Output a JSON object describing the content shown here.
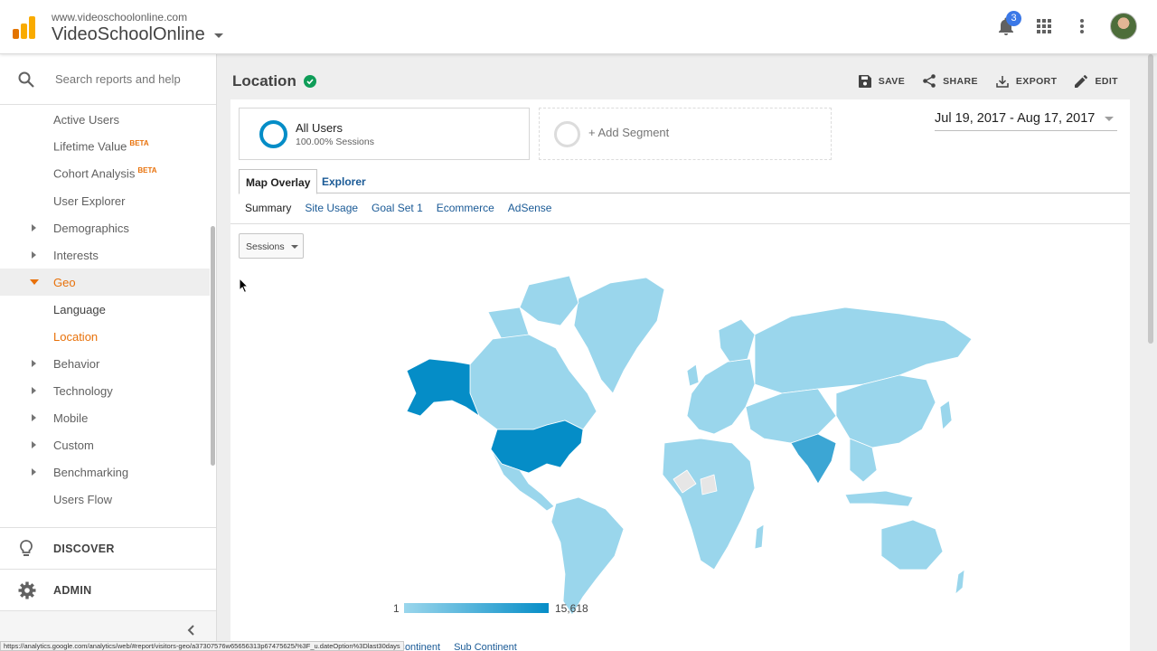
{
  "header": {
    "account_url": "www.videoschoolonline.com",
    "account_name": "VideoSchoolOnline",
    "notification_count": "3",
    "icons": [
      "analytics-logo-icon",
      "bell-icon",
      "apps-grid-icon",
      "more-vert-icon",
      "avatar"
    ]
  },
  "sidebar": {
    "search_placeholder": "Search reports and help",
    "items": [
      {
        "label": "Active Users"
      },
      {
        "label": "Lifetime Value",
        "badge": "BETA"
      },
      {
        "label": "Cohort Analysis",
        "badge": "BETA"
      },
      {
        "label": "User Explorer"
      },
      {
        "label": "Demographics"
      },
      {
        "label": "Interests"
      },
      {
        "label": "Geo"
      },
      {
        "label": "Language"
      },
      {
        "label": "Location"
      },
      {
        "label": "Behavior"
      },
      {
        "label": "Technology"
      },
      {
        "label": "Mobile"
      },
      {
        "label": "Custom"
      },
      {
        "label": "Benchmarking"
      },
      {
        "label": "Users Flow"
      }
    ],
    "discover_label": "DISCOVER",
    "admin_label": "ADMIN"
  },
  "page": {
    "title": "Location",
    "actions": {
      "save": "SAVE",
      "share": "SHARE",
      "export": "EXPORT",
      "edit": "EDIT"
    }
  },
  "segment": {
    "name": "All Users",
    "sessions": "100.00% Sessions",
    "add_label": "+ Add Segment"
  },
  "date_range": "Jul 19, 2017 - Aug 17, 2017",
  "tabs": [
    "Map Overlay",
    "Explorer"
  ],
  "subtabs": [
    "Summary",
    "Site Usage",
    "Goal Set 1",
    "Ecommerce",
    "AdSense"
  ],
  "metric": "Sessions",
  "legend": {
    "min": "1",
    "max": "15,618"
  },
  "bottom_links": [
    "Continent",
    "Sub Continent"
  ],
  "status_url": "https://analytics.google.com/analytics/web/#report/visitors-geo/a37307576w65656313p67475625/%3F_u.dateOption%3Dlast30days",
  "colors": {
    "accent_orange": "#e8710a",
    "link_blue": "#1a5a96",
    "map_dark": "#058dc7",
    "map_mid": "#3ca6d4",
    "map_light": "#9ad6ec"
  }
}
